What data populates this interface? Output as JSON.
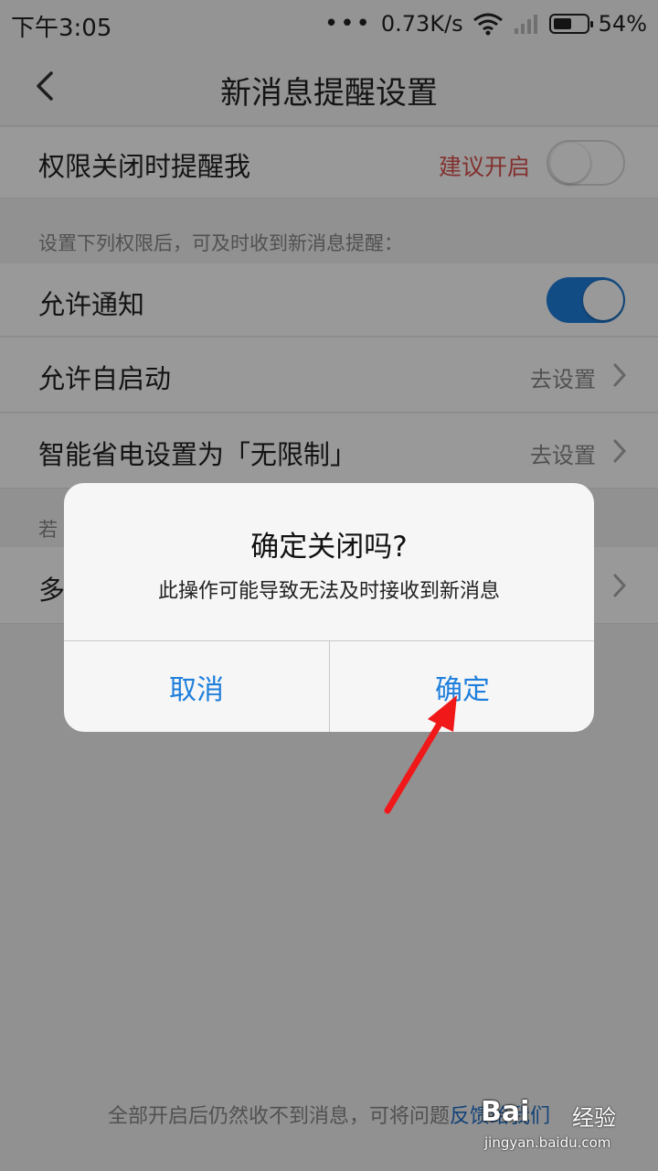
{
  "status_bar": {
    "time": "下午3:05",
    "dots": "•••",
    "speed": "0.73K/s",
    "battery": "54%",
    "battery_level": 0.54
  },
  "header": {
    "title": "新消息提醒设置"
  },
  "settings": {
    "remind_when_off": {
      "label": "权限关闭时提醒我",
      "hint": "建议开启",
      "hint_color": "#d9534f",
      "enabled": false
    },
    "section_note": "设置下列权限后，可及时收到新消息提醒：",
    "allow_notify": {
      "label": "允许通知",
      "enabled": true
    },
    "auto_start": {
      "label": "允许自启动",
      "action": "去设置"
    },
    "power_saving": {
      "label": "智能省电设置为「无限制」",
      "action": "去设置"
    },
    "partial_note": "若",
    "partial_row": "多"
  },
  "dialog": {
    "title": "确定关闭吗?",
    "message": "此操作可能导致无法及时接收到新消息",
    "cancel": "取消",
    "confirm": "确定",
    "accent": "#1f7fdc"
  },
  "footer": {
    "text": "全部开启后仍然收不到消息，可将问题",
    "link": "反馈给我们"
  },
  "watermark": {
    "brand": "Bai",
    "suffix": "经验",
    "url": "jingyan.baidu.com"
  }
}
